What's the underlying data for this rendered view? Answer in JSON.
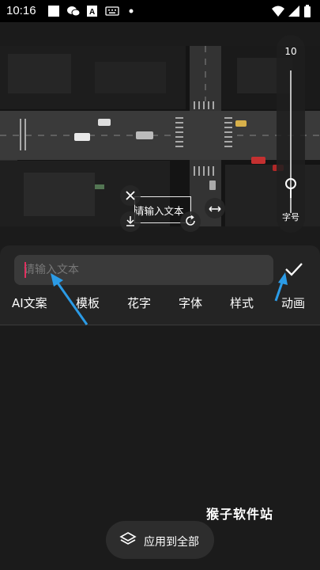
{
  "status_bar": {
    "time": "10:16",
    "icons": [
      "app-square-icon",
      "wechat-icon",
      "text-a-icon",
      "keyboard-icon",
      "dot-icon",
      "wifi-icon",
      "signal-icon",
      "battery-icon"
    ]
  },
  "font_size_slider": {
    "value": "10",
    "label": "字号",
    "level": 0.78
  },
  "text_overlay": {
    "text": "请输入文本"
  },
  "input": {
    "placeholder": "请输入文本",
    "value": ""
  },
  "tabs": [
    {
      "label": "AI文案"
    },
    {
      "label": "模板"
    },
    {
      "label": "花字"
    },
    {
      "label": "字体"
    },
    {
      "label": "样式"
    },
    {
      "label": "动画"
    }
  ],
  "watermark": "猴子软件站",
  "apply_all": {
    "label": "应用到全部"
  },
  "colors": {
    "caret": "#e0305f",
    "annotation_arrow": "#2b9be6",
    "background": "#1b1b1b"
  }
}
